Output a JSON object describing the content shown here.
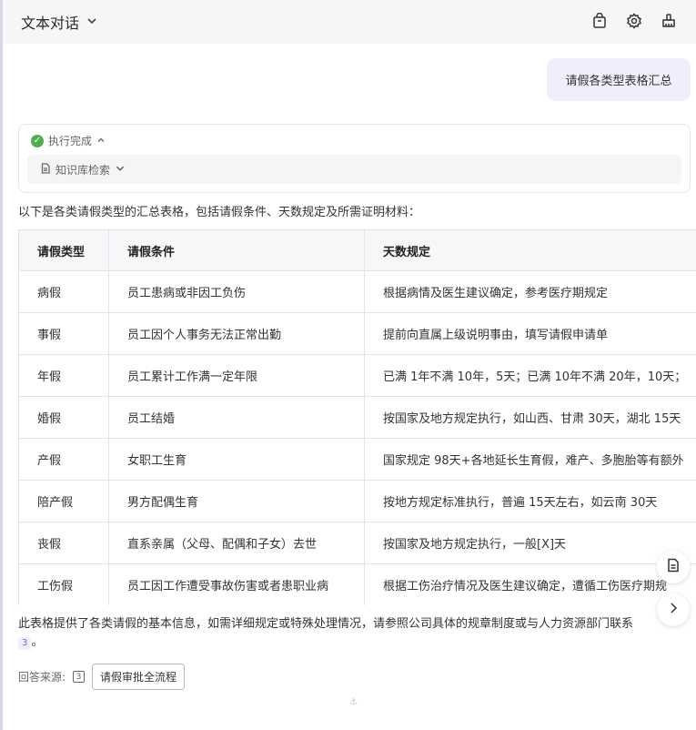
{
  "header": {
    "title": "文本对话",
    "icons": [
      "bag-icon",
      "gear-icon",
      "broom-icon"
    ]
  },
  "user_message": "请假各类型表格汇总",
  "execution": {
    "status": "执行完成",
    "tool": "知识库检索"
  },
  "answer": {
    "intro": "以下是各类请假类型的汇总表格，包括请假条件、天数规定及所需证明材料：",
    "table": {
      "headers": [
        "请假类型",
        "请假条件",
        "天数规定"
      ],
      "rows": [
        [
          "病假",
          "员工患病或非因工负伤",
          "根据病情及医生建议确定，参考医疗期规定"
        ],
        [
          "事假",
          "员工因个人事务无法正常出勤",
          "提前向直属上级说明事由，填写请假申请单"
        ],
        [
          "年假",
          "员工累计工作满一定年限",
          "已满 1年不满 10年，5天；已满 10年不满 20年，10天；"
        ],
        [
          "婚假",
          "员工结婚",
          "按国家及地方规定执行，如山西、甘肃 30天，湖北 15天"
        ],
        [
          "产假",
          "女职工生育",
          "国家规定 98天+各地延长生育假，难产、多胞胎等有额外"
        ],
        [
          "陪产假",
          "男方配偶生育",
          "按地方规定标准执行，普遍 15天左右，如云南 30天"
        ],
        [
          "丧假",
          "直系亲属（父母、配偶和子女）去世",
          "按国家及地方规定执行，一般[X]天"
        ],
        [
          "工伤假",
          "员工因工作遭受事故伤害或者患职业病",
          "根据工伤治疗情况及医生建议确定，遭循工伤医疗期规"
        ]
      ]
    },
    "note": "此表格提供了各类请假的基本信息，如需详细规定或特殊处理情况，请参照公司具体的规章制度或与人力资源部门联系",
    "note_cite": "3",
    "note_end": "。",
    "sources_label": "回答来源:",
    "source_num": "3",
    "source_doc": "请假审批全流程"
  }
}
